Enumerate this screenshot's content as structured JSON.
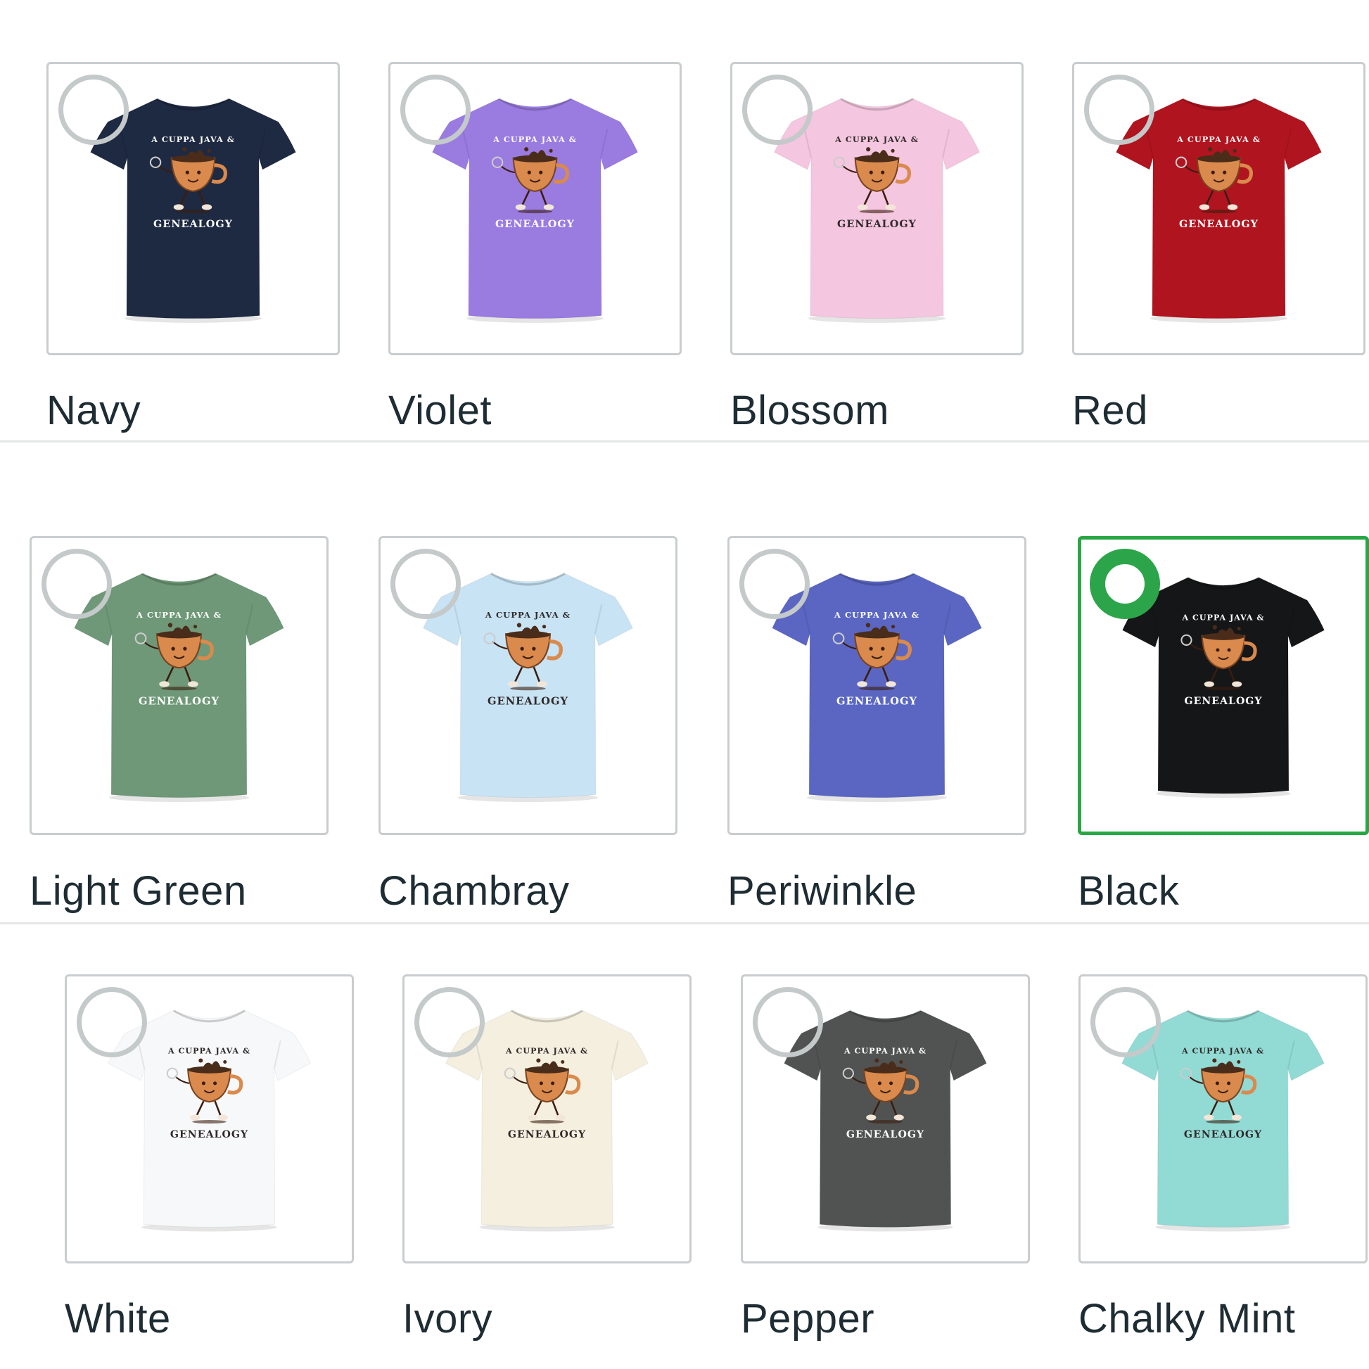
{
  "colors": {
    "selected_accent": "#2ca54a",
    "label_text": "#1e2c33",
    "card_border": "#c9cdcf"
  },
  "shirt_print": {
    "top_text": "A CUPPA JAVA &",
    "bottom_text": "GENEALOGY",
    "graphic": "walking-coffee-cup"
  },
  "swatches": [
    {
      "label": "Navy",
      "color": "#1e2942",
      "print_color": "#ffffff",
      "selected": false
    },
    {
      "label": "Violet",
      "color": "#9a7be0",
      "print_color": "#ffffff",
      "selected": false
    },
    {
      "label": "Blossom",
      "color": "#f4c6df",
      "print_color": "#2f2a2a",
      "selected": false
    },
    {
      "label": "Red",
      "color": "#b0141f",
      "print_color": "#ffffff",
      "selected": false
    },
    {
      "label": "Light Green",
      "color": "#6e9877",
      "print_color": "#ffffff",
      "selected": false
    },
    {
      "label": "Chambray",
      "color": "#c8e3f4",
      "print_color": "#2f2a2a",
      "selected": false
    },
    {
      "label": "Periwinkle",
      "color": "#5a66c2",
      "print_color": "#ffffff",
      "selected": false
    },
    {
      "label": "Black",
      "color": "#151617",
      "print_color": "#ffffff",
      "selected": true
    },
    {
      "label": "White",
      "color": "#f7f8f9",
      "print_color": "#2f2a2a",
      "selected": false
    },
    {
      "label": "Ivory",
      "color": "#f4efdf",
      "print_color": "#2f2a2a",
      "selected": false
    },
    {
      "label": "Pepper",
      "color": "#505352",
      "print_color": "#ffffff",
      "selected": false
    },
    {
      "label": "Chalky Mint",
      "color": "#92dad4",
      "print_color": "#2f2a2a",
      "selected": false
    }
  ]
}
